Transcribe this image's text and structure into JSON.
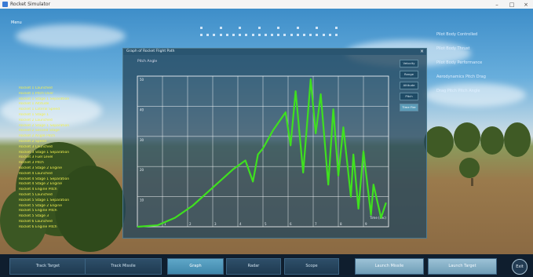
{
  "window": {
    "title": "Rocket Simulator"
  },
  "overlay": {
    "menu_label": "Menu"
  },
  "right_list": [
    "Pilot Body Controlled",
    "Pilot Body Thrust",
    "Pilot Body Performance",
    "Aerodynamics Pitch Drag",
    "Drag Pitch Pitch Angle"
  ],
  "left_list": [
    "Rocket 1 Launched",
    "Rocket 1 Pitch Over",
    "Rocket 1 Stage 1 Separation",
    "Rocket 1 Altitude",
    "Rocket 1 Lateral Speed",
    "Rocket 1 Stage 1",
    "Rocket 2 Launched",
    "Rocket 2 Stage 1 Separation",
    "Rocket 2 Second Stage",
    "Rocket 2 Angle Pitch",
    "Rocket 2 Speed",
    "Rocket 3 Launched",
    "Rocket 3 Stage 1 Separation",
    "Rocket 3 Fuel Level",
    "Rocket 3 Pitch",
    "Rocket 3 Stage 2 Engine",
    "Rocket 4 Launched",
    "Rocket 4 Stage 1 Separation",
    "Rocket 4 Stage 2 Engine",
    "Rocket 4 Engine Pitch",
    "Rocket 5 Launched",
    "Rocket 5 Stage 1 Separation",
    "Rocket 5 Stage 2 Engine",
    "Rocket 5 Engine Pitch",
    "Rocket 5 Stage 3",
    "Rocket 6 Launched",
    "Rocket 6 Engine Pitch"
  ],
  "graph_window": {
    "title": "Graph of Rocket Flight Path",
    "close_label": "×",
    "side_buttons": [
      "Velocity",
      "Range",
      "Altitude",
      "Pitch",
      "Time Fire"
    ],
    "active_side_button": 4
  },
  "toolbar": {
    "buttons": [
      "Track Target",
      "Track Missile",
      "Graph",
      "Radar",
      "Scope",
      "Launch Missile",
      "Launch Target"
    ],
    "active": 2,
    "round_label": "Exit"
  },
  "colors": {
    "line": "#3fe01f",
    "grid": "#ffffff",
    "accent": "#5fa7c8"
  },
  "chart_data": {
    "type": "line",
    "ylabel": "Pitch Angle",
    "xlabel": "Time (sec)",
    "xlim": [
      0,
      10
    ],
    "ylim": [
      0,
      50
    ],
    "xticks": [
      "0",
      "1",
      "2",
      "3",
      "4",
      "5",
      "6",
      "7",
      "8",
      "9",
      "10"
    ],
    "yticks": [
      "50",
      "40",
      "30",
      "20",
      "10"
    ],
    "series": [
      {
        "x": [
          0,
          0.8,
          1.5,
          2.2,
          3.0,
          3.8,
          4.3,
          4.6,
          4.8,
          5.0,
          5.4,
          5.9,
          6.1,
          6.3,
          6.6,
          6.9,
          7.1,
          7.3,
          7.6,
          7.8,
          8.0,
          8.2,
          8.5,
          8.6,
          8.8,
          9.0,
          9.3,
          9.4,
          9.7,
          9.9
        ],
        "y": [
          0,
          0.5,
          3,
          7,
          13,
          19,
          22,
          15,
          24,
          26,
          32,
          38,
          27,
          45,
          18,
          49,
          31,
          44,
          14,
          39,
          17,
          33,
          10,
          24,
          6,
          25,
          4,
          14,
          3,
          8
        ]
      }
    ]
  }
}
